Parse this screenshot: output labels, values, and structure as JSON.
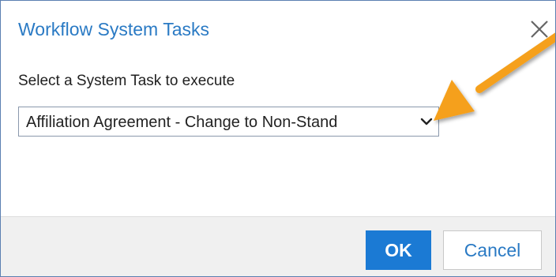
{
  "dialog": {
    "title": "Workflow System Tasks",
    "close_icon": "close-x-icon"
  },
  "form": {
    "label": "Select a System Task to execute",
    "select_value": "Affiliation Agreement - Change to Non-Stand",
    "dropdown_icon": "chevron-down-icon"
  },
  "footer": {
    "ok_label": "OK",
    "cancel_label": "Cancel"
  },
  "colors": {
    "title": "#2a7ac4",
    "primary_button": "#1b7ad4",
    "annotation_arrow": "#f5a01a",
    "footer_background": "#f0f0f0"
  }
}
